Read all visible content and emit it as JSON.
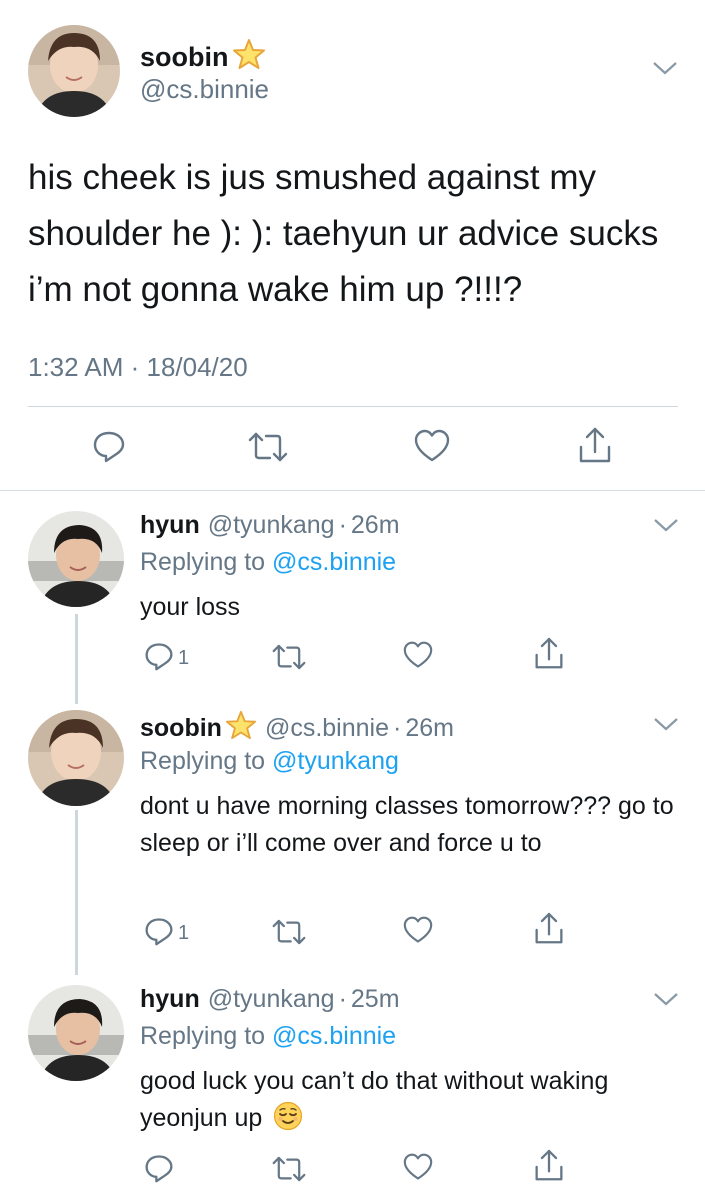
{
  "main_tweet": {
    "name": "soobin",
    "handle": "@cs.binnie",
    "text": "his cheek is jus smushed against my shoulder he ): ): taehyun ur advice sucks i’m not gonna wake him up ?!!!?",
    "timestamp": "1:32 AM · 18/04/20",
    "actions": [
      "reply-icon",
      "retweet-icon",
      "like-icon",
      "share-icon"
    ]
  },
  "replies": [
    {
      "name": "hyun",
      "handle": "@tyunkang",
      "dot": "·",
      "time": "26m",
      "replying_prefix": "Replying to",
      "replying_to": "@cs.binnie",
      "text": "your loss",
      "reply_count": "1"
    },
    {
      "name": "soobin",
      "handle": "@cs.binnie",
      "dot": "·",
      "time": "26m",
      "replying_prefix": "Replying to",
      "replying_to": "@tyunkang",
      "text": "dont u have morning classes tomorrow??? go to sleep or i’ll come over and force u to",
      "reply_count": "1"
    },
    {
      "name": "hyun",
      "handle": "@tyunkang",
      "dot": "·",
      "time": "25m",
      "replying_prefix": "Replying to",
      "replying_to": "@cs.binnie",
      "text": "good luck you can’t do that without waking yeonjun up",
      "reply_count": ""
    }
  ],
  "colors": {
    "accent": "#1da1f2",
    "secondary_text": "#657786",
    "divider": "#ccd6dd"
  }
}
